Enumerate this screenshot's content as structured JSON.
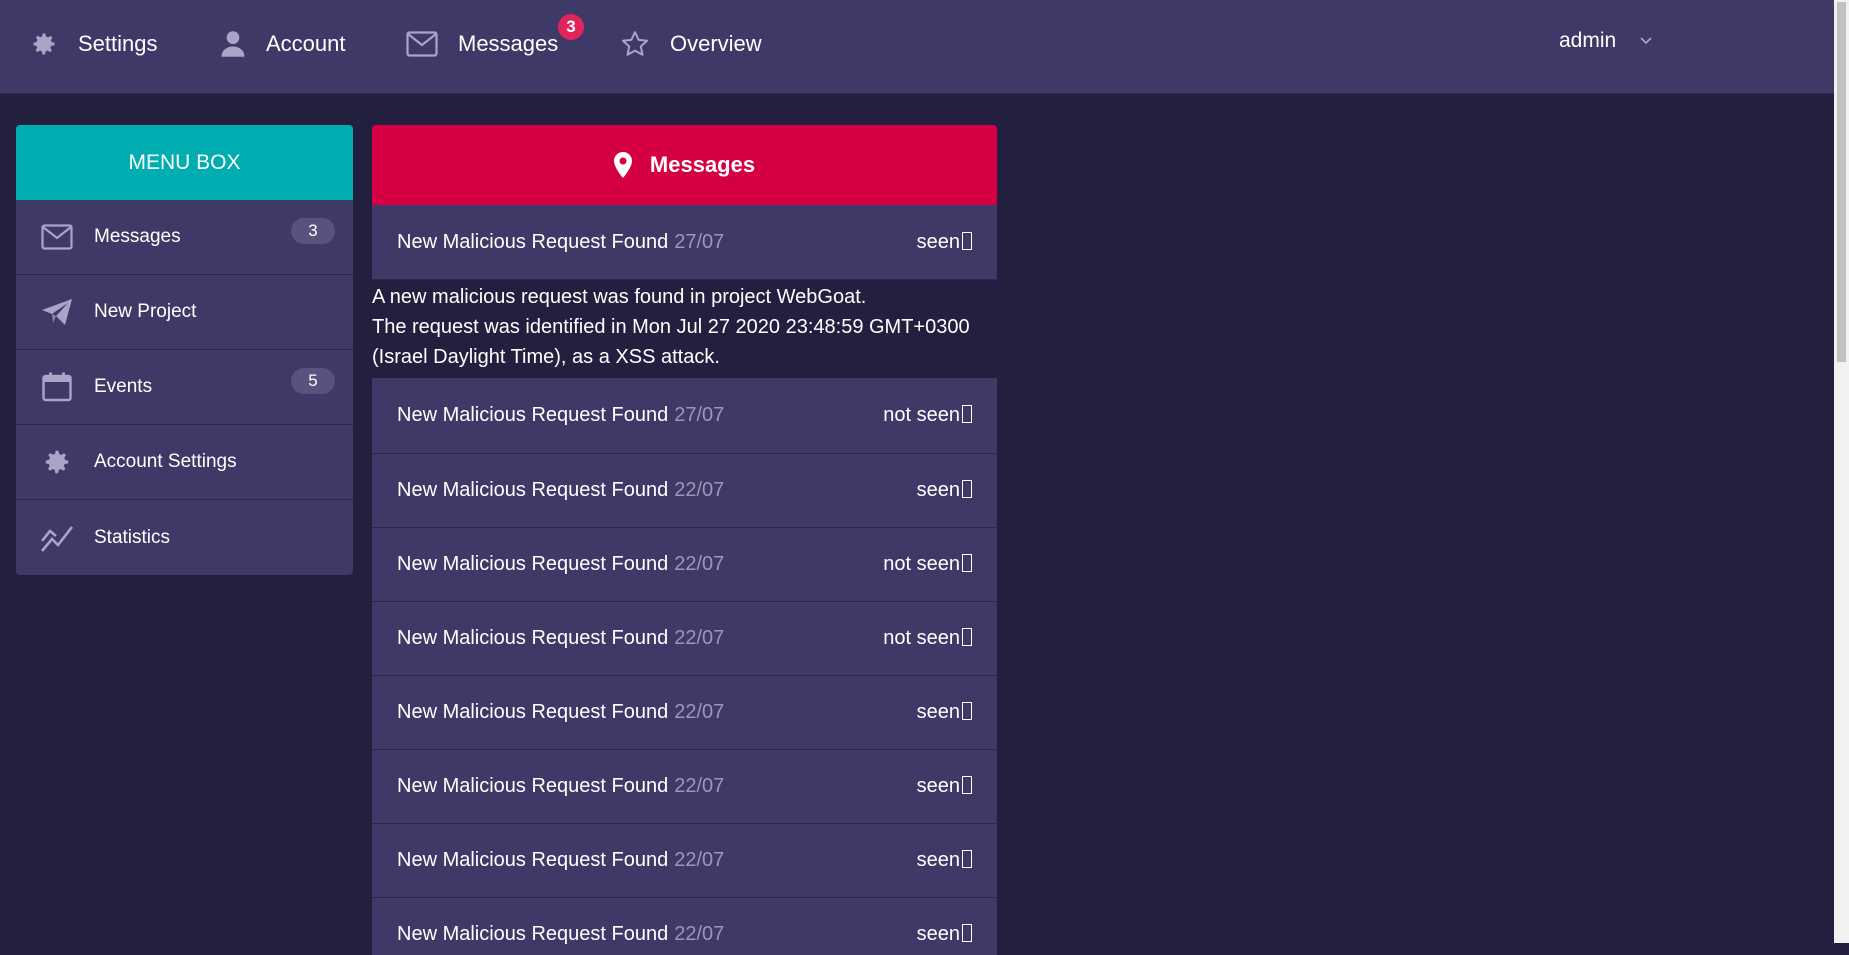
{
  "topnav": {
    "items": [
      {
        "label": "Settings",
        "icon": "gear-icon"
      },
      {
        "label": "Account",
        "icon": "user-icon"
      },
      {
        "label": "Messages",
        "icon": "envelope-icon",
        "badge": "3"
      },
      {
        "label": "Overview",
        "icon": "star-icon"
      }
    ],
    "user": "admin"
  },
  "sidebar": {
    "title": "MENU BOX",
    "items": [
      {
        "label": "Messages",
        "icon": "envelope-icon",
        "count": "3"
      },
      {
        "label": "New Project",
        "icon": "paper-plane-icon",
        "count": ""
      },
      {
        "label": "Events",
        "icon": "calendar-icon",
        "count": "5"
      },
      {
        "label": "Account Settings",
        "icon": "gear-icon",
        "count": ""
      },
      {
        "label": "Statistics",
        "icon": "chart-line-icon",
        "count": ""
      }
    ]
  },
  "messages": {
    "title": "Messages",
    "expanded_body": {
      "line1": "A new malicious request was found in project WebGoat.",
      "line2": "The request was identified in Mon Jul 27 2020 23:48:59 GMT+0300",
      "line3": "(Israel Daylight Time), as a XSS attack."
    },
    "rows": [
      {
        "title": "New Malicious Request Found",
        "date": "27/07",
        "status": "seen"
      },
      {
        "title": "New Malicious Request Found",
        "date": "27/07",
        "status": "not seen"
      },
      {
        "title": "New Malicious Request Found",
        "date": "22/07",
        "status": "seen"
      },
      {
        "title": "New Malicious Request Found",
        "date": "22/07",
        "status": "not seen"
      },
      {
        "title": "New Malicious Request Found",
        "date": "22/07",
        "status": "not seen"
      },
      {
        "title": "New Malicious Request Found",
        "date": "22/07",
        "status": "seen"
      },
      {
        "title": "New Malicious Request Found",
        "date": "22/07",
        "status": "seen"
      },
      {
        "title": "New Malicious Request Found",
        "date": "22/07",
        "status": "seen"
      },
      {
        "title": "New Malicious Request Found",
        "date": "22/07",
        "status": "seen"
      }
    ]
  },
  "colors": {
    "background": "#231f3e",
    "panel": "#3e3966",
    "menu_header": "#00adb0",
    "messages_header": "#d50044",
    "badge": "#e0245e"
  }
}
